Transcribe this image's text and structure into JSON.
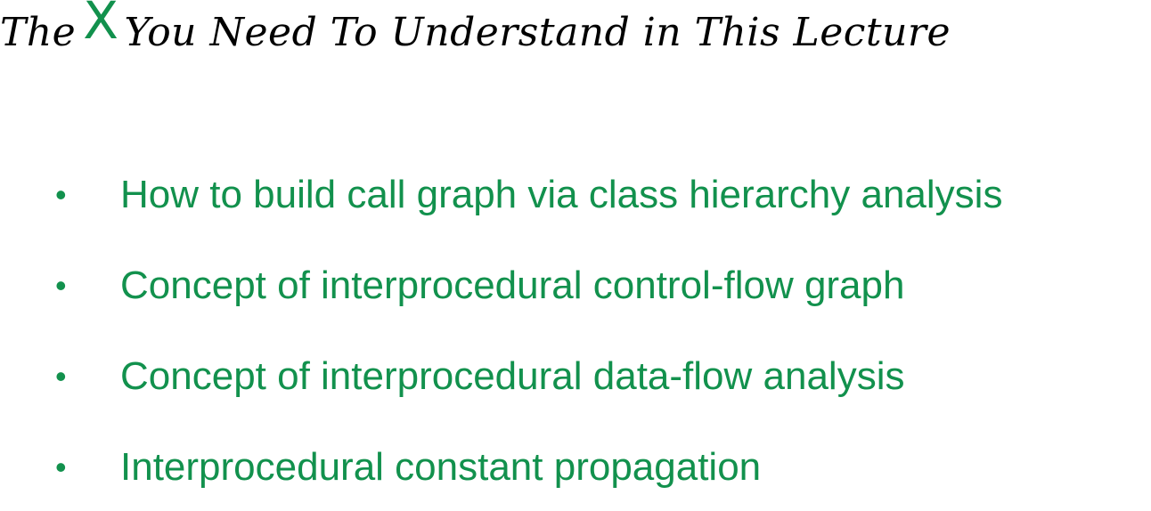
{
  "slide": {
    "title_pre": "The",
    "title_mark": "X",
    "title_post": "You Need To Understand in This Lecture",
    "accent_color": "#12914d",
    "bullet_glyph": "•",
    "bullets": [
      "How to build call graph via class hierarchy analysis",
      "Concept of interprocedural control-flow graph",
      "Concept of interprocedural data-flow analysis",
      "Interprocedural constant propagation"
    ]
  }
}
